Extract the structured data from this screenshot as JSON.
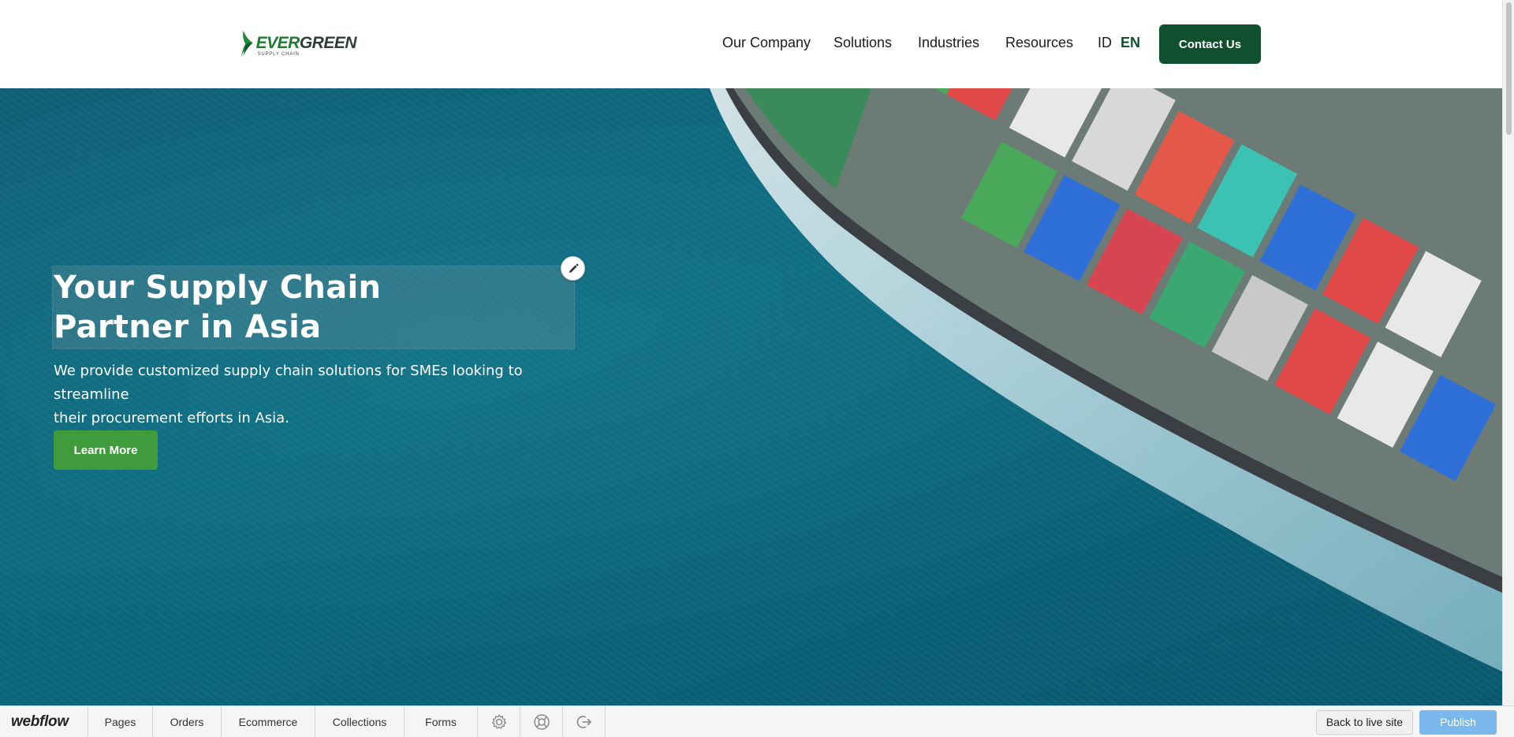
{
  "header": {
    "logo": {
      "name_part1": "EVER",
      "name_part2": "GREEN",
      "tagline": "SUPPLY CHAIN"
    },
    "nav": [
      "Our Company",
      "Solutions",
      "Industries",
      "Resources"
    ],
    "languages": {
      "id": "ID",
      "en": "EN",
      "active": "EN"
    },
    "contact_label": "Contact Us",
    "colors": {
      "brand_dark_green": "#10502f",
      "brand_green": "#1f7a32"
    }
  },
  "hero": {
    "headline_line1": "Your Supply Chain",
    "headline_line2": "Partner in Asia",
    "subtitle_line1": "We provide customized supply chain solutions for SMEs looking to streamline",
    "subtitle_line2": "their procurement efforts in Asia.",
    "cta_label": "Learn More",
    "edit_icon": "pencil-icon",
    "colors": {
      "cta": "#3f9b3c",
      "sea": "#0c6b80"
    }
  },
  "webflow_bar": {
    "logo": "webflow",
    "items": [
      "Pages",
      "Orders",
      "Ecommerce",
      "Collections",
      "Forms"
    ],
    "icons": [
      "gear-icon",
      "help-icon",
      "logout-icon"
    ],
    "back_label": "Back to live site",
    "publish_label": "Publish",
    "colors": {
      "publish": "#7ab8ec"
    }
  }
}
